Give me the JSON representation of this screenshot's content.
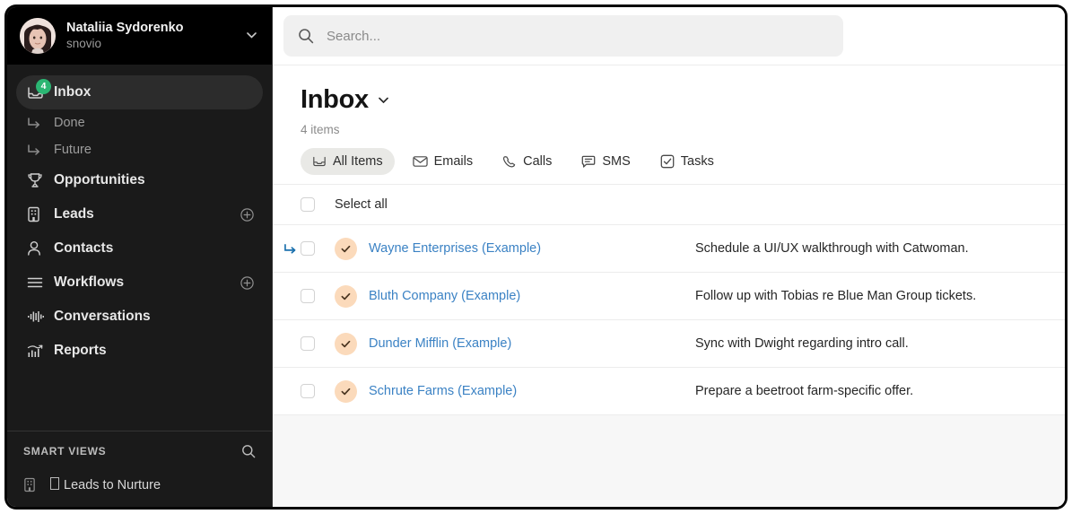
{
  "workspace": {
    "user_name": "Nataliia Sydorenko",
    "org_name": "snovio",
    "avatar_icon": "user-photo-avatar",
    "caret_icon": "chevron-down-icon"
  },
  "sidebar": {
    "items": [
      {
        "label": "Inbox",
        "icon": "inbox-icon",
        "badge": "4",
        "active": true,
        "sub": false,
        "plus": false
      },
      {
        "label": "Done",
        "icon": "arrow-turn-down-right-icon",
        "badge": "",
        "active": false,
        "sub": true,
        "plus": false
      },
      {
        "label": "Future",
        "icon": "arrow-turn-down-right-icon",
        "badge": "",
        "active": false,
        "sub": true,
        "plus": false
      },
      {
        "label": "Opportunities",
        "icon": "trophy-icon",
        "badge": "",
        "active": false,
        "sub": false,
        "plus": false
      },
      {
        "label": "Leads",
        "icon": "building-icon",
        "badge": "",
        "active": false,
        "sub": false,
        "plus": true
      },
      {
        "label": "Contacts",
        "icon": "person-icon",
        "badge": "",
        "active": false,
        "sub": false,
        "plus": false
      },
      {
        "label": "Workflows",
        "icon": "lines-icon",
        "badge": "",
        "active": false,
        "sub": false,
        "plus": true
      },
      {
        "label": "Conversations",
        "icon": "waveform-icon",
        "badge": "",
        "active": false,
        "sub": false,
        "plus": false
      },
      {
        "label": "Reports",
        "icon": "chart-line-icon",
        "badge": "",
        "active": false,
        "sub": false,
        "plus": false
      }
    ],
    "smart_views": {
      "title": "SMART VIEWS",
      "search_icon": "search-icon",
      "items": [
        {
          "label": "Leads to Nurture",
          "icon": "building-icon",
          "prefix_glyph": "missing-glyph-box"
        }
      ]
    }
  },
  "search": {
    "value": "",
    "placeholder": "Search...",
    "icon": "search-icon"
  },
  "page": {
    "title": "Inbox",
    "title_caret_icon": "chevron-down-icon",
    "item_count": "4 items",
    "tabs": [
      {
        "label": "All Items",
        "icon": "inbox-icon",
        "active": true
      },
      {
        "label": "Emails",
        "icon": "envelope-icon",
        "active": false
      },
      {
        "label": "Calls",
        "icon": "phone-icon",
        "active": false
      },
      {
        "label": "SMS",
        "icon": "chat-bubble-icon",
        "active": false
      },
      {
        "label": "Tasks",
        "icon": "checkbox-check-icon",
        "active": false
      }
    ],
    "select_all_label": "Select all",
    "rows": [
      {
        "name": "Wayne Enterprises (Example)",
        "description": "Schedule a UI/UX walkthrough with Catwoman.",
        "avatar_icon": "check-icon",
        "has_arrow": true,
        "checked": false
      },
      {
        "name": "Bluth Company (Example)",
        "description": "Follow up with Tobias re Blue Man Group tickets.",
        "avatar_icon": "check-icon",
        "has_arrow": false,
        "checked": false
      },
      {
        "name": "Dunder Mifflin (Example)",
        "description": "Sync with Dwight regarding intro call.",
        "avatar_icon": "check-icon",
        "has_arrow": false,
        "checked": false
      },
      {
        "name": "Schrute Farms (Example)",
        "description": "Prepare a beetroot farm-specific offer.",
        "avatar_icon": "check-icon",
        "has_arrow": false,
        "checked": false
      }
    ]
  },
  "colors": {
    "sidebar_bg": "#1a1a1a",
    "workspace_header_bg": "#000000",
    "badge_green": "#2bb673",
    "link_blue": "#3b82c4",
    "arrow_blue": "#1a70ad",
    "avatar_peach": "#fbdabb",
    "content_bg": "#f7f7f7",
    "tab_active_bg": "#e9e9e6"
  }
}
